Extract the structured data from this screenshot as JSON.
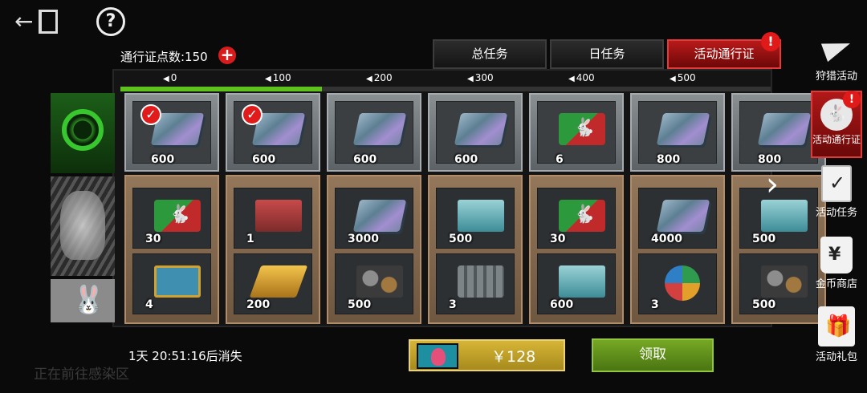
{
  "top": {
    "back_icon": "back-exit-icon",
    "help_symbol": "?"
  },
  "points": {
    "label": "通行证点数:150",
    "add_symbol": "+"
  },
  "tabs": [
    {
      "label": "总任务"
    },
    {
      "label": "日任务"
    },
    {
      "label": "活动通行证",
      "active": true,
      "alert": "!"
    }
  ],
  "progress": {
    "fill_fraction": 0.31,
    "milestones": [
      "0",
      "100",
      "200",
      "300",
      "400",
      "500"
    ],
    "tick_symbol": "◀"
  },
  "tiers": {
    "free_icon": "biohazard-icon",
    "paid_icon": "rabbit-portrait-icon",
    "bonus_icon": "playboy-bunny-icon",
    "bonus_glyph": "🐰"
  },
  "columns": [
    {
      "top_qty": "600",
      "top_icon": "cash-stack-icon",
      "claimed": true,
      "slot1_qty": "30",
      "slot1_icon": "rabbit-card-icon",
      "slot2_qty": "4",
      "slot2_icon": "blue-supply-crate-icon"
    },
    {
      "top_qty": "600",
      "top_icon": "cash-stack-icon",
      "claimed": true,
      "slot1_qty": "1",
      "slot1_icon": "generator-icon",
      "slot2_qty": "200",
      "slot2_icon": "gold-bars-icon"
    },
    {
      "top_qty": "600",
      "top_icon": "cash-stack-icon",
      "claimed": false,
      "slot1_qty": "3000",
      "slot1_icon": "cash-stack-icon",
      "slot2_qty": "500",
      "slot2_icon": "mechanical-parts-icon"
    },
    {
      "top_qty": "600",
      "top_icon": "cash-stack-icon",
      "claimed": false,
      "slot1_qty": "500",
      "slot1_icon": "teal-ammo-crate-icon",
      "slot2_qty": "3",
      "slot2_icon": "gray-crate-icon"
    },
    {
      "top_qty": "6",
      "top_icon": "rabbit-card-icon",
      "claimed": false,
      "slot1_qty": "30",
      "slot1_icon": "rabbit-card-icon",
      "slot2_qty": "600",
      "slot2_icon": "teal-ammo-crate-icon"
    },
    {
      "top_qty": "800",
      "top_icon": "cash-stack-icon",
      "claimed": false,
      "slot1_qty": "4000",
      "slot1_icon": "cash-stack-icon",
      "slot2_qty": "3",
      "slot2_icon": "ball-icon"
    },
    {
      "top_qty": "800",
      "top_icon": "cash-stack-icon",
      "claimed": false,
      "slot1_qty": "500",
      "slot1_icon": "teal-ammo-crate-icon",
      "slot2_qty": "500",
      "slot2_icon": "mechanical-parts-icon"
    }
  ],
  "next_arrow": "›",
  "bottom": {
    "timer": "1天 20:51:16后消失",
    "hint": "正在前往感染区",
    "price": "￥128",
    "claim": "领取"
  },
  "sidebar": [
    {
      "label": "狩猎活动",
      "icon": "paper-plane-icon"
    },
    {
      "label": "活动通行证",
      "icon": "rabbit-badge-icon",
      "active": true,
      "alert": "!"
    },
    {
      "label": "活动任务",
      "icon": "task-checklist-icon"
    },
    {
      "label": "金币商店",
      "icon": "shopping-bag-icon"
    },
    {
      "label": "活动礼包",
      "icon": "gift-box-icon"
    }
  ],
  "colors": {
    "accent_red": "#c01a1a",
    "progress_green": "#5ec11d",
    "claim_green": "#5f9020",
    "price_gold": "#c4a22b"
  }
}
